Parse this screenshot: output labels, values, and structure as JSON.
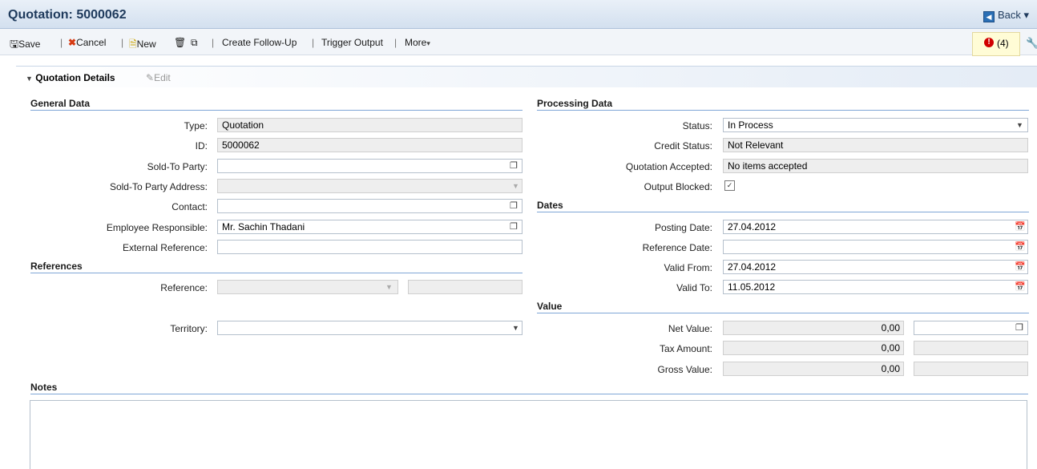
{
  "header": {
    "title": "Quotation: 5000062",
    "back_label": "Back"
  },
  "toolbar": {
    "save": "Save",
    "cancel": "Cancel",
    "new": "New",
    "create_follow_up": "Create Follow-Up",
    "trigger_output": "Trigger Output",
    "more": "More",
    "messages_count": "(4)"
  },
  "section": {
    "title": "Quotation Details",
    "edit": "Edit"
  },
  "general": {
    "title": "General Data",
    "type_label": "Type:",
    "type_value": "Quotation",
    "id_label": "ID:",
    "id_value": "5000062",
    "sold_to_label": "Sold-To Party:",
    "sold_to_value": "",
    "sold_to_addr_label": "Sold-To Party Address:",
    "sold_to_addr_value": "",
    "contact_label": "Contact:",
    "contact_value": "",
    "employee_label": "Employee Responsible:",
    "employee_value": "Mr. Sachin Thadani",
    "ext_ref_label": "External Reference:",
    "ext_ref_value": ""
  },
  "references": {
    "title": "References",
    "reference_label": "Reference:",
    "reference_value": "",
    "territory_label": "Territory:",
    "territory_value": ""
  },
  "processing": {
    "title": "Processing Data",
    "status_label": "Status:",
    "status_value": "In Process",
    "credit_label": "Credit Status:",
    "credit_value": "Not Relevant",
    "accepted_label": "Quotation Accepted:",
    "accepted_value": "No items accepted",
    "blocked_label": "Output Blocked:",
    "blocked_checked": true
  },
  "dates": {
    "title": "Dates",
    "posting_label": "Posting Date:",
    "posting_value": "27.04.2012",
    "refdate_label": "Reference Date:",
    "refdate_value": "",
    "validfrom_label": "Valid From:",
    "validfrom_value": "27.04.2012",
    "validto_label": "Valid To:",
    "validto_value": "11.05.2012"
  },
  "value": {
    "title": "Value",
    "net_label": "Net Value:",
    "net_value": "0,00",
    "tax_label": "Tax Amount:",
    "tax_value": "0,00",
    "gross_label": "Gross Value:",
    "gross_value": "0,00"
  },
  "notes": {
    "title": "Notes",
    "text": ""
  },
  "icons": {
    "save": "save-icon",
    "cancel": "cancel-icon",
    "new": "new-document-icon",
    "delete": "trash-icon",
    "copy": "copy-icon",
    "error": "error-icon",
    "personalize": "wrench-icon",
    "back": "back-icon"
  },
  "colors": {
    "title_text": "#1e3a5c",
    "group_line": "#7fa6d6",
    "cancel_x": "#d63a12",
    "error": "#d10000"
  }
}
